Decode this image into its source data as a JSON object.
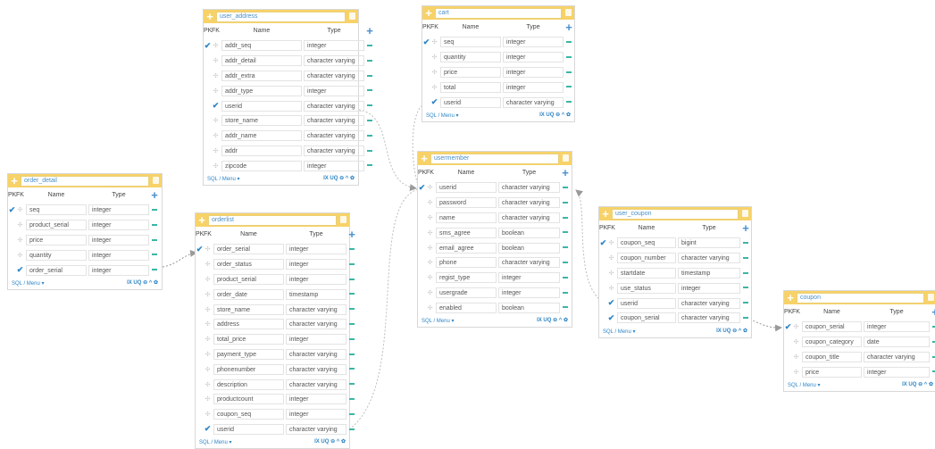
{
  "header": {
    "pk": "PK",
    "fk": "FK",
    "name": "Name",
    "type": "Type"
  },
  "footer": {
    "sql_menu": "SQL / Menu ▾",
    "tools": "IX UQ ⊖ ^ ✿"
  },
  "icons": {
    "add": "plus-icon",
    "delete": "trash-icon",
    "remove": "minus-icon",
    "primary_key": "check-icon",
    "row": "grip-icon"
  },
  "colors": {
    "title_bar": "#f7d268",
    "table_name": "#4a90c8",
    "add_button": "#4a8fd0",
    "remove_button": "#3bb6a5",
    "check": "#2f86c6",
    "link": "#bdbdbd"
  },
  "tables": {
    "user_address": {
      "name": "user_address",
      "columns": [
        {
          "name": "addr_seq",
          "type": "integer",
          "pk": true,
          "fk": false
        },
        {
          "name": "addr_detail",
          "type": "character varying",
          "pk": false,
          "fk": false
        },
        {
          "name": "addr_extra",
          "type": "character varying",
          "pk": false,
          "fk": false
        },
        {
          "name": "addr_type",
          "type": "integer",
          "pk": false,
          "fk": false
        },
        {
          "name": "userid",
          "type": "character varying",
          "pk": false,
          "fk": true
        },
        {
          "name": "store_name",
          "type": "character varying",
          "pk": false,
          "fk": false
        },
        {
          "name": "addr_name",
          "type": "character varying",
          "pk": false,
          "fk": false
        },
        {
          "name": "addr",
          "type": "character varying",
          "pk": false,
          "fk": false
        },
        {
          "name": "zipcode",
          "type": "integer",
          "pk": false,
          "fk": false
        }
      ]
    },
    "cart": {
      "name": "cart",
      "columns": [
        {
          "name": "seq",
          "type": "integer",
          "pk": true,
          "fk": false
        },
        {
          "name": "quantity",
          "type": "integer",
          "pk": false,
          "fk": false
        },
        {
          "name": "price",
          "type": "integer",
          "pk": false,
          "fk": false
        },
        {
          "name": "total",
          "type": "integer",
          "pk": false,
          "fk": false
        },
        {
          "name": "userid",
          "type": "character varying",
          "pk": false,
          "fk": true
        }
      ]
    },
    "order_detail": {
      "name": "order_detail",
      "columns": [
        {
          "name": "seq",
          "type": "integer",
          "pk": true,
          "fk": false
        },
        {
          "name": "product_serial",
          "type": "integer",
          "pk": false,
          "fk": false
        },
        {
          "name": "price",
          "type": "integer",
          "pk": false,
          "fk": false
        },
        {
          "name": "quantity",
          "type": "integer",
          "pk": false,
          "fk": false
        },
        {
          "name": "order_serial",
          "type": "integer",
          "pk": false,
          "fk": true
        }
      ]
    },
    "orderlist": {
      "name": "orderlist",
      "columns": [
        {
          "name": "order_serial",
          "type": "integer",
          "pk": true,
          "fk": false
        },
        {
          "name": "order_status",
          "type": "integer",
          "pk": false,
          "fk": false
        },
        {
          "name": "product_serial",
          "type": "integer",
          "pk": false,
          "fk": false
        },
        {
          "name": "order_date",
          "type": "timestamp",
          "pk": false,
          "fk": false
        },
        {
          "name": "store_name",
          "type": "character varying",
          "pk": false,
          "fk": false
        },
        {
          "name": "address",
          "type": "character varying",
          "pk": false,
          "fk": false
        },
        {
          "name": "total_price",
          "type": "integer",
          "pk": false,
          "fk": false
        },
        {
          "name": "payment_type",
          "type": "character varying",
          "pk": false,
          "fk": false
        },
        {
          "name": "phonenumber",
          "type": "character varying",
          "pk": false,
          "fk": false
        },
        {
          "name": "description",
          "type": "character varying",
          "pk": false,
          "fk": false
        },
        {
          "name": "productcount",
          "type": "integer",
          "pk": false,
          "fk": false
        },
        {
          "name": "coupon_seq",
          "type": "integer",
          "pk": false,
          "fk": false
        },
        {
          "name": "userid",
          "type": "character varying",
          "pk": false,
          "fk": true
        }
      ]
    },
    "usermember": {
      "name": "usermember",
      "columns": [
        {
          "name": "userid",
          "type": "character varying",
          "pk": true,
          "fk": false
        },
        {
          "name": "password",
          "type": "character varying",
          "pk": false,
          "fk": false
        },
        {
          "name": "name",
          "type": "character varying",
          "pk": false,
          "fk": false
        },
        {
          "name": "sms_agree",
          "type": "boolean",
          "pk": false,
          "fk": false
        },
        {
          "name": "email_agree",
          "type": "boolean",
          "pk": false,
          "fk": false
        },
        {
          "name": "phone",
          "type": "character varying",
          "pk": false,
          "fk": false
        },
        {
          "name": "regist_type",
          "type": "integer",
          "pk": false,
          "fk": false
        },
        {
          "name": "usergrade",
          "type": "integer",
          "pk": false,
          "fk": false
        },
        {
          "name": "enabled",
          "type": "boolean",
          "pk": false,
          "fk": false
        }
      ]
    },
    "user_coupon": {
      "name": "user_coupon",
      "columns": [
        {
          "name": "coupon_seq",
          "type": "bigint",
          "pk": true,
          "fk": false
        },
        {
          "name": "coupon_number",
          "type": "character varying",
          "pk": false,
          "fk": false
        },
        {
          "name": "startdate",
          "type": "timestamp",
          "pk": false,
          "fk": false
        },
        {
          "name": "use_status",
          "type": "integer",
          "pk": false,
          "fk": false
        },
        {
          "name": "userid",
          "type": "character varying",
          "pk": false,
          "fk": true
        },
        {
          "name": "coupon_serial",
          "type": "character varying",
          "pk": false,
          "fk": true
        }
      ]
    },
    "coupon": {
      "name": "coupon",
      "columns": [
        {
          "name": "coupon_serial",
          "type": "integer",
          "pk": true,
          "fk": false
        },
        {
          "name": "coupon_category",
          "type": "date",
          "pk": false,
          "fk": false
        },
        {
          "name": "coupon_title",
          "type": "character varying",
          "pk": false,
          "fk": false
        },
        {
          "name": "price",
          "type": "integer",
          "pk": false,
          "fk": false
        }
      ]
    }
  }
}
